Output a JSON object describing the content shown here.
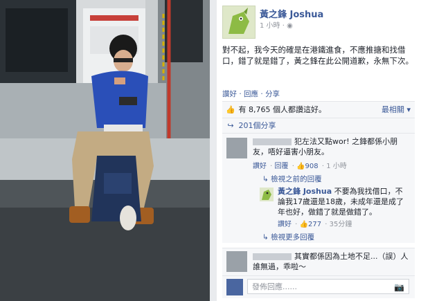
{
  "post": {
    "author": "黃之鋒 Joshua",
    "time": "1 小時",
    "privacy_icon": "globe-icon",
    "text": "對不起，我今天的確是在港鐵進食，不應推搪和找借口，錯了就是錯了，黃之鋒在此公開道歉，永無下次。",
    "actions": {
      "like": "讚好",
      "comment": "回應",
      "share": "分享"
    }
  },
  "stats": {
    "likes_text": "有 8,765 個人都讚這好。",
    "most_relevant": "最相關",
    "shares_text": "201個分享"
  },
  "comments": [
    {
      "name_blurred": true,
      "text": "犯左法又點wor! 之鋒都係小朋友，唔好逼害小朋友。",
      "meta": {
        "like": "讚好",
        "reply": "回覆",
        "likes": "908",
        "time": "1 小時"
      },
      "view_previous": "檢視之前的回覆",
      "reply": {
        "name": "黃之鋒 Joshua",
        "text": "不要為我找借口，不論我17歲還是18歲，未成年還是成了年也好，做錯了就是做錯了。",
        "meta": {
          "like": "讚好",
          "likes": "277",
          "time": "35分鐘"
        }
      },
      "view_more": "檢視更多回覆"
    },
    {
      "name_blurred": true,
      "text": "其實都係因為土地不足...（誤）人誰無過，乖啦～"
    }
  ],
  "reply_box": {
    "placeholder": "發佈回應......"
  }
}
